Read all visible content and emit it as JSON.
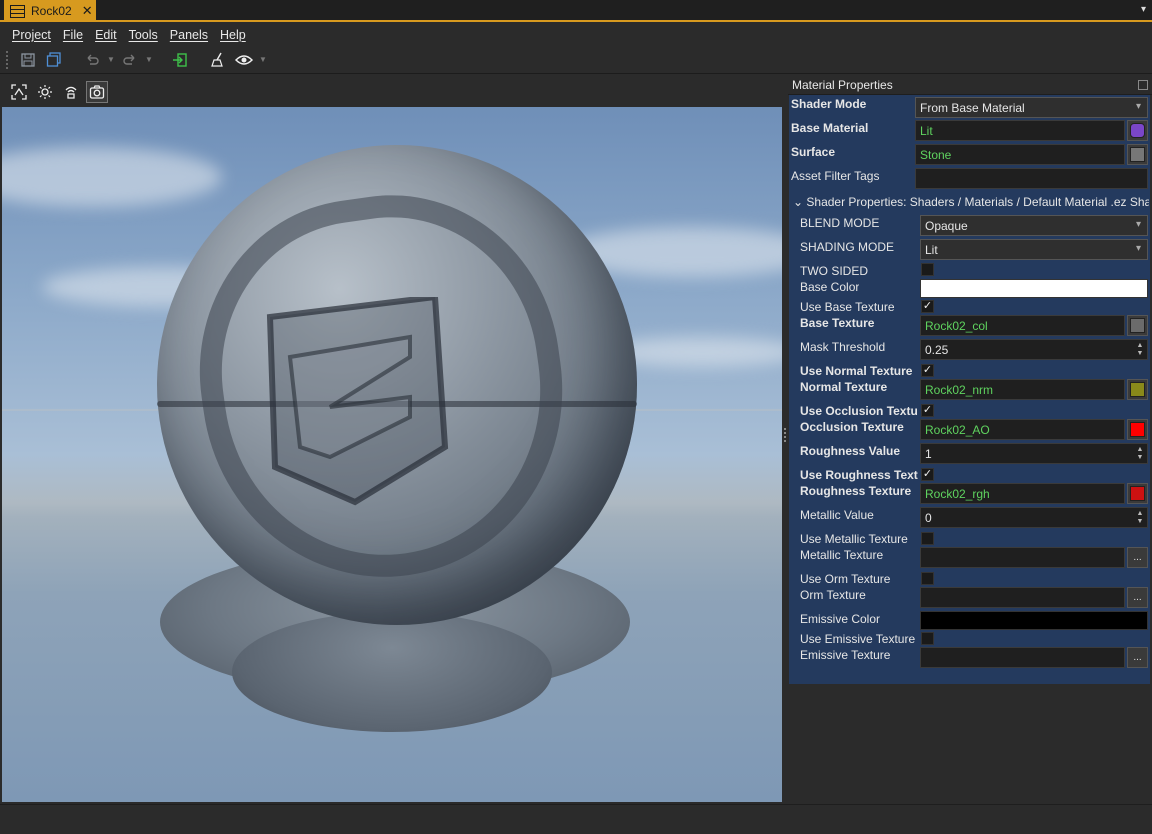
{
  "window": {
    "tab_title": "Rock02",
    "close_glyph": "✕",
    "dropdown_glyph": "▾"
  },
  "menu": [
    "Project",
    "File",
    "Edit",
    "Tools",
    "Panels",
    "Help"
  ],
  "toolbar_icons": [
    "save-icon",
    "save-all-icon",
    "undo-icon",
    "redo-icon",
    "export-icon",
    "clean-icon",
    "visibility-icon"
  ],
  "viewport_icons": [
    "camera-focus-icon",
    "light-icon",
    "render-mode-icon",
    "screenshot-icon"
  ],
  "panel": {
    "title": "Material Properties",
    "shader_mode": {
      "label": "Shader Mode",
      "value": "From Base Material"
    },
    "base_material": {
      "label": "Base Material",
      "value": "Lit",
      "swatch": "#7a46c8"
    },
    "surface": {
      "label": "Surface",
      "value": "Stone"
    },
    "asset_filter_tags": {
      "label": "Asset Filter Tags",
      "value": ""
    },
    "group_header": "Shader Properties: Shaders / Materials / Default Material .ez Shader",
    "blend_mode": {
      "label": "BLEND MODE",
      "value": "Opaque"
    },
    "shading_mode": {
      "label": "SHADING MODE",
      "value": "Lit"
    },
    "two_sided": {
      "label": "TWO SIDED",
      "checked": false
    },
    "base_color": {
      "label": "Base Color",
      "color": "#ffffff"
    },
    "use_base_texture": {
      "label": "Use Base Texture",
      "checked": true
    },
    "base_texture": {
      "label": "Base Texture",
      "value": "Rock02_col",
      "swatch": "#6b6b6b"
    },
    "mask_threshold": {
      "label": "Mask Threshold",
      "value": "0.25"
    },
    "use_normal_texture": {
      "label": "Use Normal Texture",
      "checked": true
    },
    "normal_texture": {
      "label": "Normal Texture",
      "value": "Rock02_nrm",
      "swatch": "#8a8a1a"
    },
    "use_occlusion_texture": {
      "label": "Use Occlusion Texture",
      "checked": true
    },
    "occlusion_texture": {
      "label": "Occlusion Texture",
      "value": "Rock02_AO",
      "swatch": "#ff0000"
    },
    "roughness_value": {
      "label": "Roughness Value",
      "value": "1"
    },
    "use_roughness_texture": {
      "label": "Use Roughness Texture",
      "checked": true
    },
    "roughness_texture": {
      "label": "Roughness Texture",
      "value": "Rock02_rgh",
      "swatch": "#cc1111"
    },
    "metallic_value": {
      "label": "Metallic Value",
      "value": "0"
    },
    "use_metallic_texture": {
      "label": "Use Metallic Texture",
      "checked": false
    },
    "metallic_texture": {
      "label": "Metallic Texture",
      "value": "",
      "button": "..."
    },
    "use_orm_texture": {
      "label": "Use Orm Texture",
      "checked": false
    },
    "orm_texture": {
      "label": "Orm Texture",
      "value": "",
      "button": "..."
    },
    "emissive_color": {
      "label": "Emissive Color",
      "color": "#000000"
    },
    "use_emissive_texture": {
      "label": "Use Emissive Texture",
      "checked": false
    },
    "emissive_texture": {
      "label": "Emissive Texture",
      "value": "",
      "button": "..."
    }
  },
  "colors": {
    "accent": "#d79a1f",
    "panel_bg": "#243a5e",
    "green_text": "#5fd35f"
  }
}
